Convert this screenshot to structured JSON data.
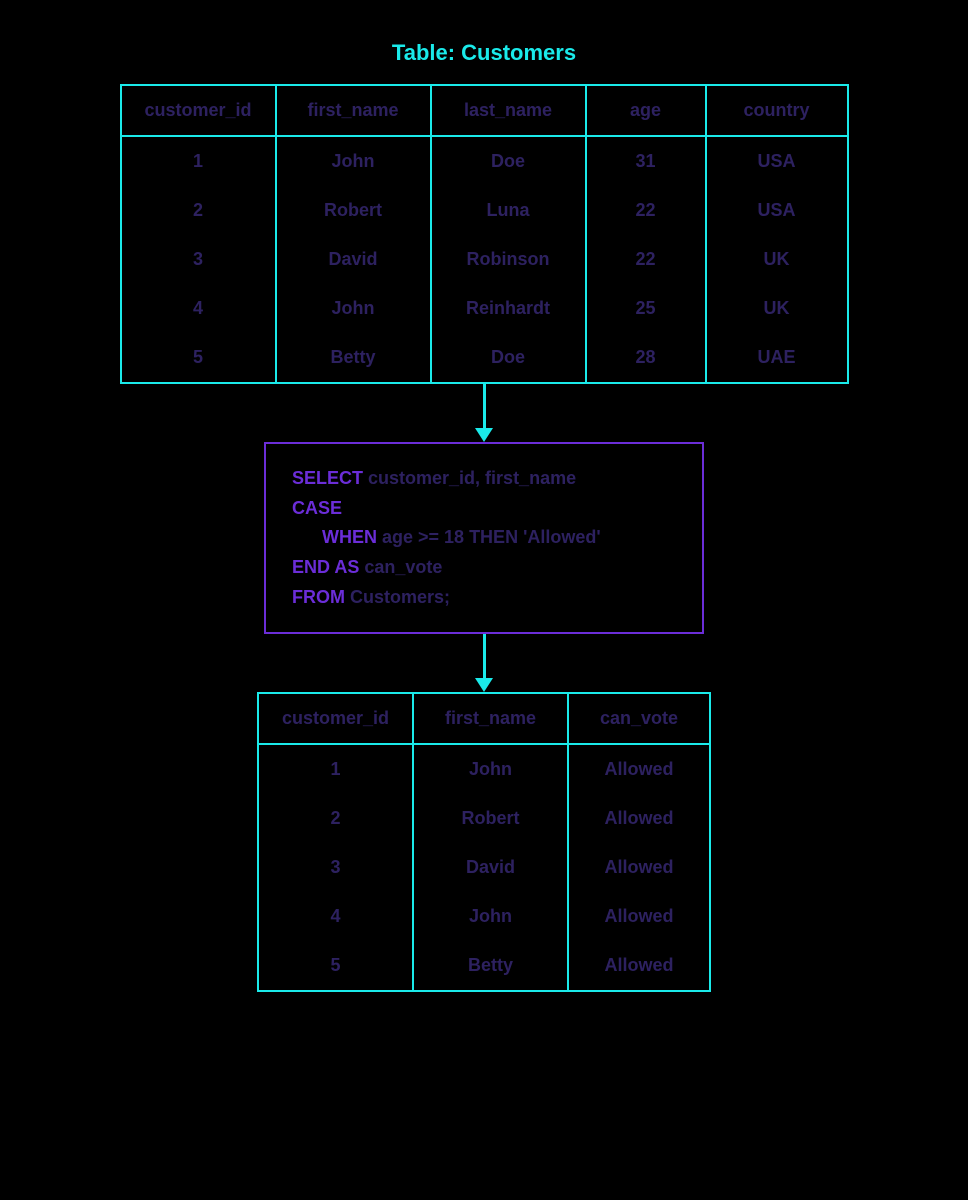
{
  "title": "Table: Customers",
  "source_table": {
    "headers": [
      "customer_id",
      "first_name",
      "last_name",
      "age",
      "country"
    ],
    "rows": [
      [
        "1",
        "John",
        "Doe",
        "31",
        "USA"
      ],
      [
        "2",
        "Robert",
        "Luna",
        "22",
        "USA"
      ],
      [
        "3",
        "David",
        "Robinson",
        "22",
        "UK"
      ],
      [
        "4",
        "John",
        "Reinhardt",
        "25",
        "UK"
      ],
      [
        "5",
        "Betty",
        "Doe",
        "28",
        "UAE"
      ]
    ]
  },
  "sql": {
    "kw_select": "SELECT",
    "select_cols": " customer_id, first_name",
    "kw_case": "CASE",
    "kw_when": "WHEN",
    "when_cond": " age >= 18 THEN 'Allowed'",
    "kw_end_as": "END AS",
    "end_as_alias": " can_vote",
    "kw_from": "FROM",
    "from_table": " Customers;"
  },
  "result_table": {
    "headers": [
      "customer_id",
      "first_name",
      "can_vote"
    ],
    "rows": [
      [
        "1",
        "John",
        "Allowed"
      ],
      [
        "2",
        "Robert",
        "Allowed"
      ],
      [
        "3",
        "David",
        "Allowed"
      ],
      [
        "4",
        "John",
        "Allowed"
      ],
      [
        "5",
        "Betty",
        "Allowed"
      ]
    ]
  }
}
